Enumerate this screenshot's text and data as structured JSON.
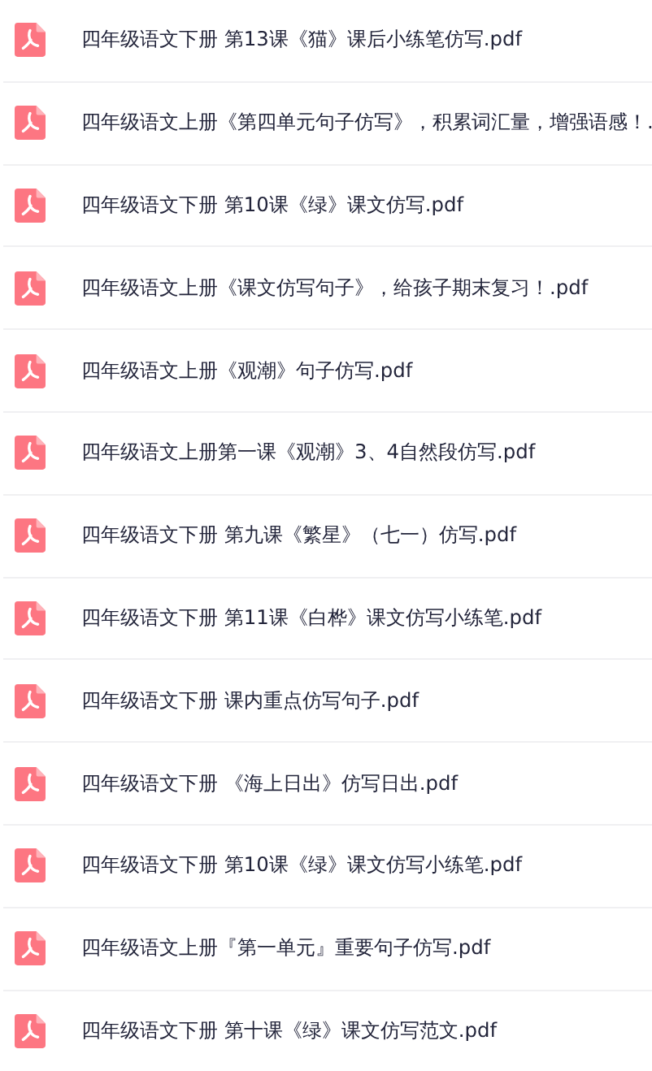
{
  "files": [
    {
      "name": "四年级语文下册 第13课《猫》课后小练笔仿写.pdf"
    },
    {
      "name": "四年级语文上册《第四单元句子仿写》，积累词汇量，增强语感！."
    },
    {
      "name": "四年级语文下册 第10课《绿》课文仿写.pdf"
    },
    {
      "name": "四年级语文上册《课文仿写句子》，给孩子期末复习！.pdf"
    },
    {
      "name": "四年级语文上册《观潮》句子仿写.pdf"
    },
    {
      "name": "四年级语文上册第一课《观潮》3、4自然段仿写.pdf"
    },
    {
      "name": "四年级语文下册 第九课《繁星》（七一）仿写.pdf"
    },
    {
      "name": "四年级语文下册 第11课《白桦》课文仿写小练笔.pdf"
    },
    {
      "name": "四年级语文下册 课内重点仿写句子.pdf"
    },
    {
      "name": "四年级语文下册 《海上日出》仿写日出.pdf"
    },
    {
      "name": "四年级语文下册 第10课《绿》课文仿写小练笔.pdf"
    },
    {
      "name": "四年级语文上册『第一单元』重要句子仿写.pdf"
    },
    {
      "name": "四年级语文下册 第十课《绿》课文仿写范文.pdf"
    }
  ]
}
